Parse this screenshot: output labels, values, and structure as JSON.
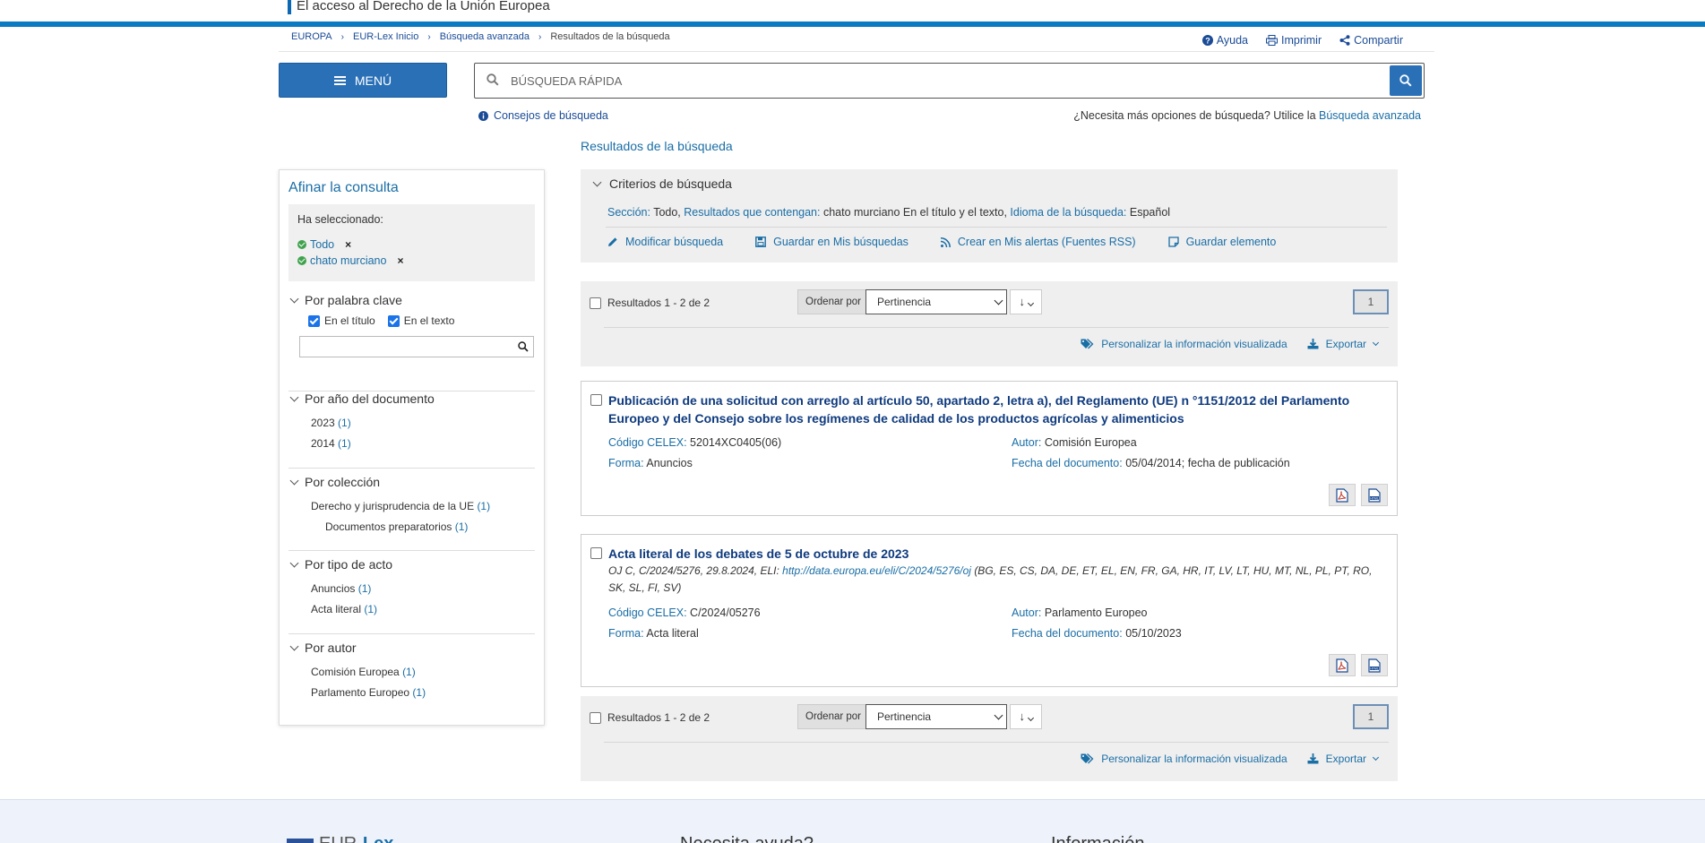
{
  "header": {
    "site_title": "El acceso al Derecho de la Unión Europea",
    "breadcrumbs": [
      "EUROPA",
      "EUR-Lex Inicio",
      "Búsqueda avanzada",
      "Resultados de la búsqueda"
    ],
    "util_links": {
      "help": "Ayuda",
      "print": "Imprimir",
      "share": "Compartir"
    }
  },
  "toolbar": {
    "menu_label": "MENÚ",
    "search_placeholder": "BÚSQUEDA RÁPIDA",
    "tips_label": "Consejos de búsqueda",
    "adv_prefix": "¿Necesita más opciones de búsqueda? Utilice la",
    "adv_link": "Búsqueda avanzada"
  },
  "page_title": "Resultados de la búsqueda",
  "sidebar": {
    "title": "Afinar la consulta",
    "selected_label": "Ha seleccionado:",
    "chips": [
      "Todo",
      "chato murciano"
    ],
    "keyword": {
      "heading": "Por palabra clave",
      "in_title": "En el título",
      "in_text": "En el texto"
    },
    "year": {
      "heading": "Por año del documento",
      "items": [
        {
          "label": "2023",
          "count": "(1)"
        },
        {
          "label": "2014",
          "count": "(1)"
        }
      ]
    },
    "collection": {
      "heading": "Por colección",
      "items": [
        {
          "label": "Derecho y jurisprudencia de la UE",
          "count": "(1)"
        },
        {
          "label": "Documentos preparatorios",
          "count": "(1)"
        }
      ]
    },
    "act_type": {
      "heading": "Por tipo de acto",
      "items": [
        {
          "label": "Anuncios",
          "count": "(1)"
        },
        {
          "label": "Acta literal",
          "count": "(1)"
        }
      ]
    },
    "author": {
      "heading": "Por autor",
      "items": [
        {
          "label": "Comisión Europea",
          "count": "(1)"
        },
        {
          "label": "Parlamento Europeo",
          "count": "(1)"
        }
      ]
    }
  },
  "criteria": {
    "heading": "Criterios de búsqueda",
    "section_key": "Sección:",
    "section_val": "Todo,",
    "contains_key": "Resultados que contengan:",
    "contains_val": "chato murciano En el título y el texto,",
    "lang_key": "Idioma de la búsqueda:",
    "lang_val": "Español",
    "actions": {
      "modify": "Modificar búsqueda",
      "save_search": "Guardar en Mis búsquedas",
      "alerts": "Crear en Mis alertas (Fuentes RSS)",
      "save_item": "Guardar elemento"
    }
  },
  "results_bar": {
    "count": "Resultados 1 - 2  de 2",
    "order_label": "Ordenar por",
    "order_value": "Pertinencia",
    "sort_dir": "↓",
    "page": "1",
    "customize": "Personalizar la información visualizada",
    "export": "Exportar"
  },
  "results": [
    {
      "title": "Publicación de una solicitud con arreglo al artículo 50, apartado 2, letra a), del Reglamento (UE) n °1151/2012 del Parlamento Europeo y del Consejo sobre los regímenes de calidad de los productos agrícolas y alimenticios",
      "celex_key": "Código CELEX:",
      "celex": "52014XC0405(06)",
      "author_key": "Autor:",
      "author": "Comisión Europea",
      "form_key": "Forma:",
      "form": "Anuncios",
      "date_key": "Fecha del documento:",
      "date": "05/04/2014; fecha de publicación"
    },
    {
      "title": "Acta literal de los debates de 5 de octubre de 2023",
      "meta_prefix": "OJ C, C/2024/5276, 29.8.2024, ELI:",
      "meta_link": "http://data.europa.eu/eli/C/2024/5276/oj",
      "meta_suffix": "(BG, ES, CS, DA, DE, ET, EL, EN, FR, GA, HR, IT, LV, LT, HU, MT, NL, PL, PT, RO, SK, SL, FI, SV)",
      "celex_key": "Código CELEX:",
      "celex": "C/2024/05276",
      "author_key": "Autor:",
      "author": "Parlamento Europeo",
      "form_key": "Forma:",
      "form": "Acta literal",
      "date_key": "Fecha del documento:",
      "date": "05/10/2023"
    }
  ],
  "footer": {
    "logo_a": "EUR-",
    "logo_b": "Lex",
    "help_heading": "Necesita ayuda?",
    "info_heading": "Información"
  },
  "colors": {
    "primary": "#2a70b7",
    "link": "#1a6ea6",
    "title": "#0e3a7e",
    "topbar": "#0a7bc1"
  }
}
